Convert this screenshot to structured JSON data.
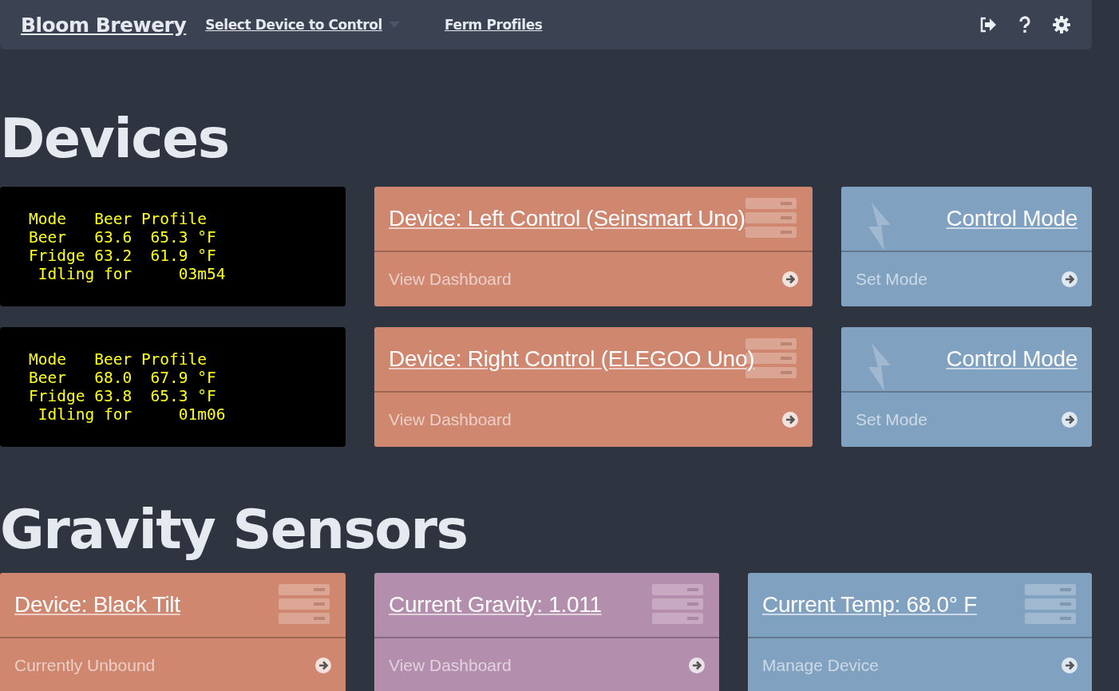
{
  "navbar": {
    "brand": "Bloom Brewery",
    "device_menu": "Select Device to Control",
    "profiles_link": "Ferm Profiles"
  },
  "devices_heading": "Devices",
  "devices": [
    {
      "lcd": [
        "Mode   Beer Profile",
        "Beer   63.6  65.3 °F",
        "Fridge 63.2  61.9 °F",
        " Idling for     03m54"
      ],
      "device": {
        "title": "Device: Left Control (Seinsmart Uno)",
        "link": "View Dashboard"
      },
      "mode": {
        "title": "Control Mode",
        "link": "Set Mode"
      }
    },
    {
      "lcd": [
        "Mode   Beer Profile",
        "Beer   68.0  67.9 °F",
        "Fridge 63.8  65.3 °F",
        " Idling for     01m06"
      ],
      "device": {
        "title": "Device: Right Control (ELEGOO Uno)",
        "link": "View Dashboard"
      },
      "mode": {
        "title": "Control Mode",
        "link": "Set Mode"
      }
    }
  ],
  "gravity_heading": "Gravity Sensors",
  "gravity_cards": [
    {
      "title": "Device: Black Tilt",
      "link": "Currently Unbound",
      "color": "#d08770"
    },
    {
      "title": "Current Gravity: 1.011",
      "link": "View Dashboard",
      "color": "#b48ead"
    },
    {
      "title": "Current Temp: 68.0° F",
      "link": "Manage Device",
      "color": "#81a1c1"
    }
  ]
}
